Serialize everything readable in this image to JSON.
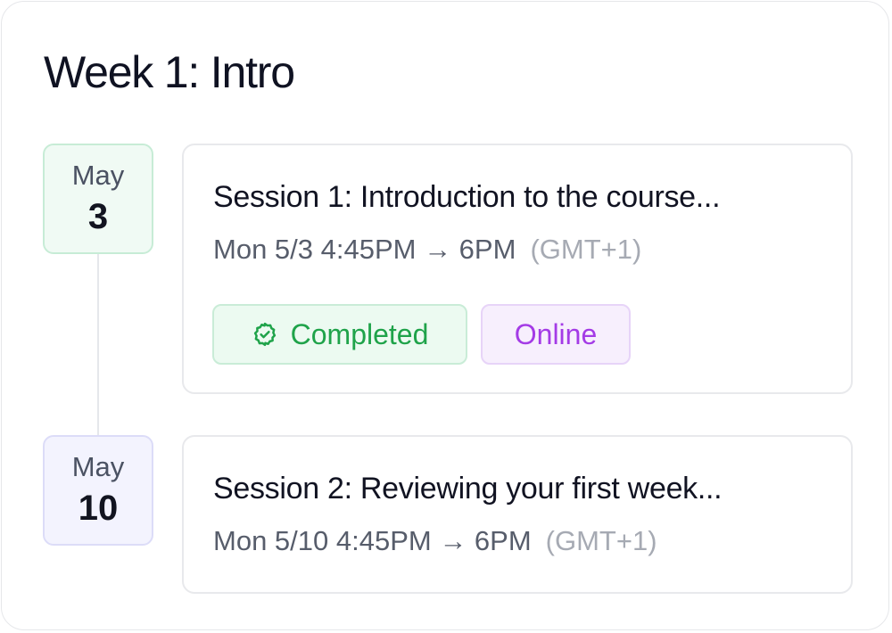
{
  "week": {
    "title": "Week 1: Intro"
  },
  "sessions": [
    {
      "date": {
        "month": "May",
        "day": "3"
      },
      "title": "Session 1: Introduction to the course...",
      "time": "Mon 5/3 4:45PM → 6PM",
      "timezone": "(GMT+1)",
      "badges": [
        {
          "label": "Completed",
          "icon": "check-badge-icon",
          "color": "#1fa34a"
        },
        {
          "label": "Online",
          "color": "#a43be6"
        }
      ]
    },
    {
      "date": {
        "month": "May",
        "day": "10"
      },
      "title": "Session 2: Reviewing your first week...",
      "time": "Mon 5/10 4:45PM → 6PM",
      "timezone": "(GMT+1)"
    }
  ],
  "colors": {
    "completed_green": "#1fa34a",
    "online_purple": "#a43be6",
    "date_box_green_bg": "#f0faf4",
    "date_box_purple_bg": "#f3f3fe"
  }
}
